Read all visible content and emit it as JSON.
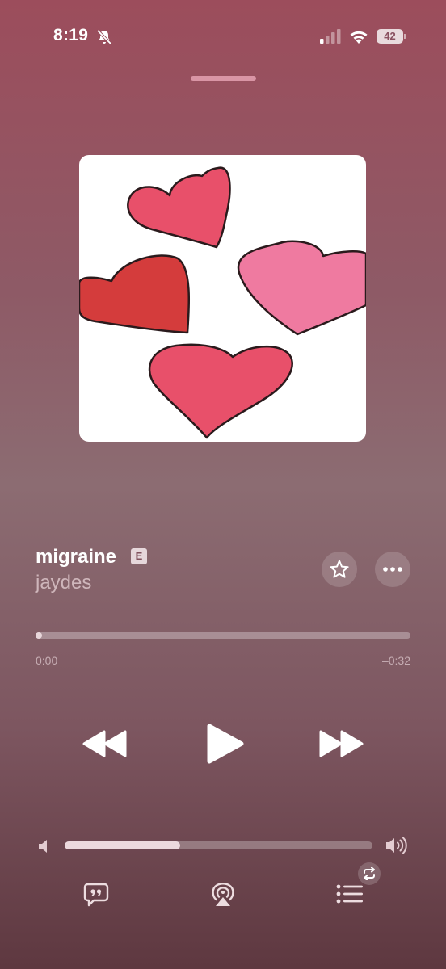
{
  "status_bar": {
    "time": "8:19",
    "battery": "42",
    "icons": [
      "bell-slash-icon",
      "cellular-signal-icon",
      "wifi-icon",
      "battery-icon"
    ]
  },
  "track": {
    "title": "migraine",
    "explicit_badge": "E",
    "artist": "jaydes"
  },
  "progress": {
    "elapsed": "0:00",
    "remaining": "–0:32",
    "fraction": 0.01
  },
  "volume": {
    "level": 0.375
  },
  "colors": {
    "heart_pink": "#e8506a",
    "heart_red": "#d43c3c",
    "heart_light": "#ef7aa0"
  },
  "icons": {
    "favorite": "star-icon",
    "more": "ellipsis-icon",
    "rewind": "backward-icon",
    "play": "play-icon",
    "forward": "forward-icon",
    "volume_low": "speaker-low-icon",
    "volume_high": "speaker-high-icon",
    "lyrics": "lyrics-quote-icon",
    "airplay": "airplay-icon",
    "queue": "queue-list-icon",
    "repeat": "repeat-icon"
  }
}
